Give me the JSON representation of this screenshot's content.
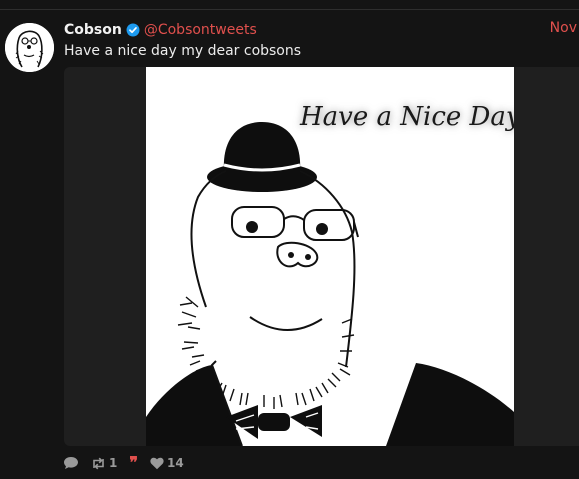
{
  "post": {
    "display_name": "Cobson",
    "handle": "@Cobsontweets",
    "date": "Nov",
    "text": "Have a nice day my dear cobsons",
    "media": {
      "caption": "Have a Nice Day..."
    },
    "actions": {
      "reply_icon": "reply-icon",
      "repost_icon": "repost-icon",
      "repost_count": "1",
      "quote_icon": "quote-icon",
      "quote_glyph": "❞",
      "like_icon": "heart-icon",
      "like_count": "14"
    }
  },
  "colors": {
    "background": "#141414",
    "accent": "#e0504d",
    "verified": "#1d9bf0",
    "muted": "#9a9a9a"
  }
}
